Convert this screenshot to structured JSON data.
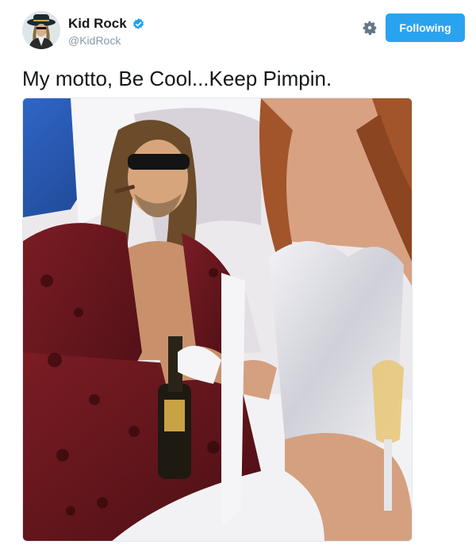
{
  "tweet": {
    "display_name": "Kid Rock",
    "handle": "@KidRock",
    "text": "My motto, Be Cool...Keep Pimpin.",
    "follow_label": "Following"
  },
  "icons": {
    "verified": "verified-badge-icon",
    "settings": "gear-icon"
  },
  "colors": {
    "brand_blue": "#2aa3ef",
    "verified_blue": "#1da1f2",
    "handle_gray": "#8899a6"
  }
}
